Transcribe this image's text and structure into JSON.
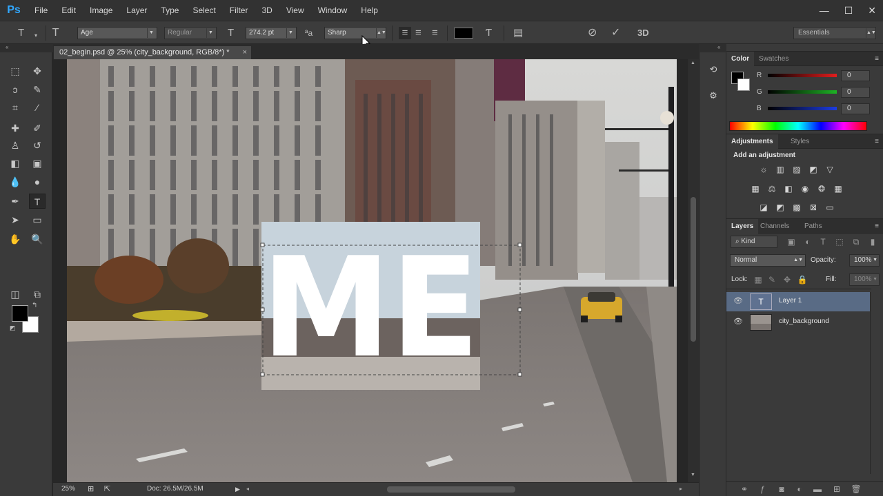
{
  "app": {
    "logo": "Ps"
  },
  "menu": [
    "File",
    "Edit",
    "Image",
    "Layer",
    "Type",
    "Select",
    "Filter",
    "3D",
    "View",
    "Window",
    "Help"
  ],
  "window_controls": {
    "minimize": "—",
    "maximize": "☐",
    "close": "✕"
  },
  "options": {
    "font_family": "Age",
    "font_style": "Regular",
    "font_size": "274.2 pt",
    "antialias_icon_text": "a",
    "antialias": "Sharp",
    "workspace": "Essentials",
    "three_d_label": "3D",
    "text_color": "#000000"
  },
  "document": {
    "tab_title": "02_begin.psd @ 25% (city_background, RGB/8*) *",
    "close": "×",
    "overlay_text": "ME"
  },
  "statusbar": {
    "zoom": "25%",
    "doc_info": "Doc: 26.5M/26.5M"
  },
  "color_panel": {
    "tabs": [
      "Color",
      "Swatches"
    ],
    "channels": [
      {
        "label": "R",
        "value": "0",
        "color": "#e11d1d"
      },
      {
        "label": "G",
        "value": "0",
        "color": "#1db324"
      },
      {
        "label": "B",
        "value": "0",
        "color": "#1d3ce1"
      }
    ]
  },
  "adjustments_panel": {
    "tabs": [
      "Adjustments",
      "Styles"
    ],
    "title": "Add an adjustment"
  },
  "layers_panel": {
    "tabs": [
      "Layers",
      "Channels",
      "Paths"
    ],
    "filter_kind": "Kind",
    "blend_mode": "Normal",
    "opacity_label": "Opacity:",
    "opacity": "100%",
    "lock_label": "Lock:",
    "fill_label": "Fill:",
    "fill": "100%",
    "layers": [
      {
        "name": "Layer 1",
        "type": "text",
        "selected": true
      },
      {
        "name": "city_background",
        "type": "image",
        "selected": false
      }
    ]
  }
}
